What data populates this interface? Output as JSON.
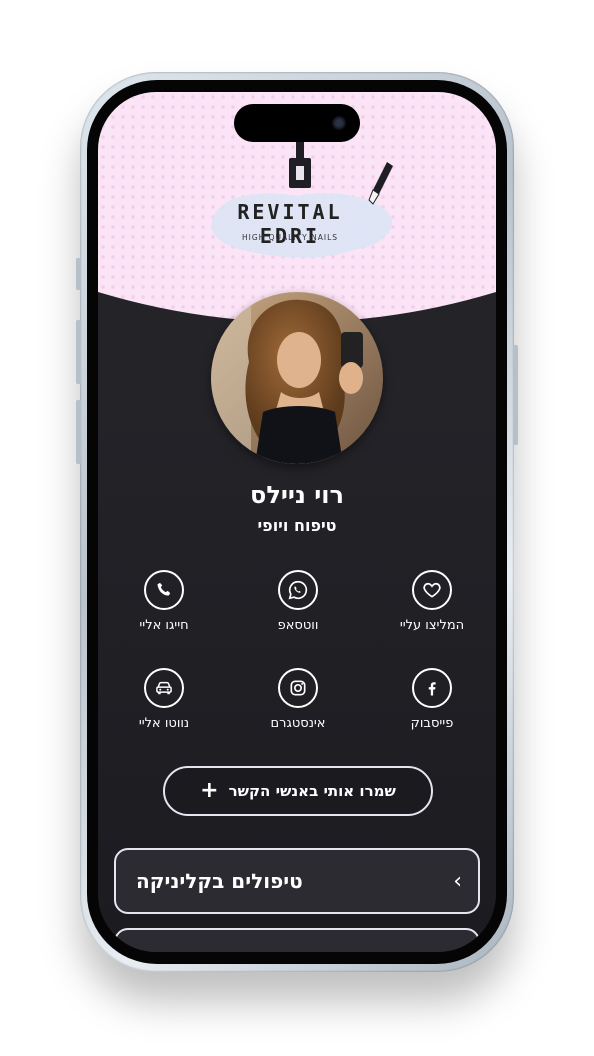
{
  "logo": {
    "brand": "REVITAL EDRI",
    "tagline": "HIGH QUALITY NAILS"
  },
  "profile": {
    "name": "רוי ניילס",
    "title": "טיפוח ויופי"
  },
  "actions": [
    {
      "label": "המליצו עליי",
      "icon": "heart-icon"
    },
    {
      "label": "ווטסאפ",
      "icon": "whatsapp-icon"
    },
    {
      "label": "חייגו אליי",
      "icon": "phone-icon"
    },
    {
      "label": "פייסבוק",
      "icon": "facebook-icon"
    },
    {
      "label": "אינסטגרם",
      "icon": "instagram-icon"
    },
    {
      "label": "נווטו אליי",
      "icon": "car-icon"
    }
  ],
  "save_contact": {
    "label": "שמרו אותי באנשי הקשר",
    "icon": "plus-icon"
  },
  "accordion": {
    "title": "טיפולים בקליניקה"
  },
  "colors": {
    "accent": "#fae4f6",
    "background": "#1b1b20",
    "outline": "#e9e3f0"
  }
}
